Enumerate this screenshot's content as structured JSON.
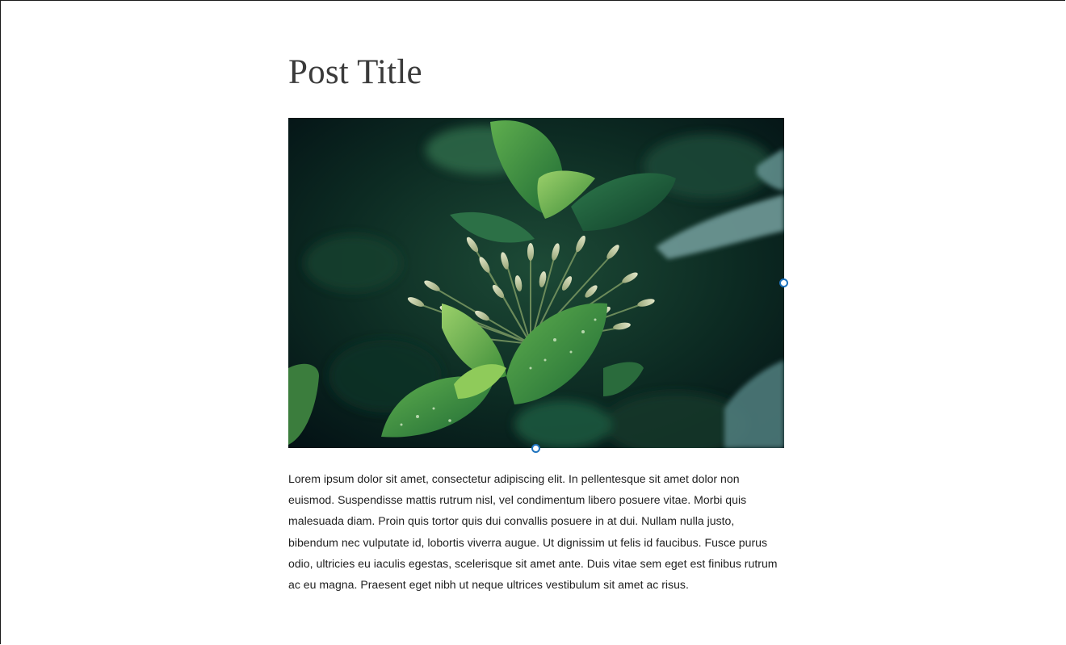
{
  "post": {
    "title": "Post Title",
    "image": {
      "subject": "green leaves with flower buds and water droplets on dark background"
    },
    "body": "Lorem ipsum dolor sit amet, consectetur adipiscing elit. In pellentesque sit amet dolor non euismod. Suspendisse mattis rutrum nisl, vel condimentum libero posuere vitae. Morbi quis malesuada diam. Proin quis tortor quis dui convallis posuere in at dui. Nullam nulla justo, bibendum nec vulputate id, lobortis viverra augue. Ut dignissim ut felis id faucibus. Fusce purus odio, ultricies eu iaculis egestas, scelerisque sit amet ante. Duis vitae sem eget est finibus rutrum ac eu magna. Praesent eget nibh ut neque ultrices vestibulum sit amet ac risus."
  },
  "colors": {
    "handle": "#1e73be",
    "title": "#3a3a3a",
    "body": "#1f1f1f"
  }
}
